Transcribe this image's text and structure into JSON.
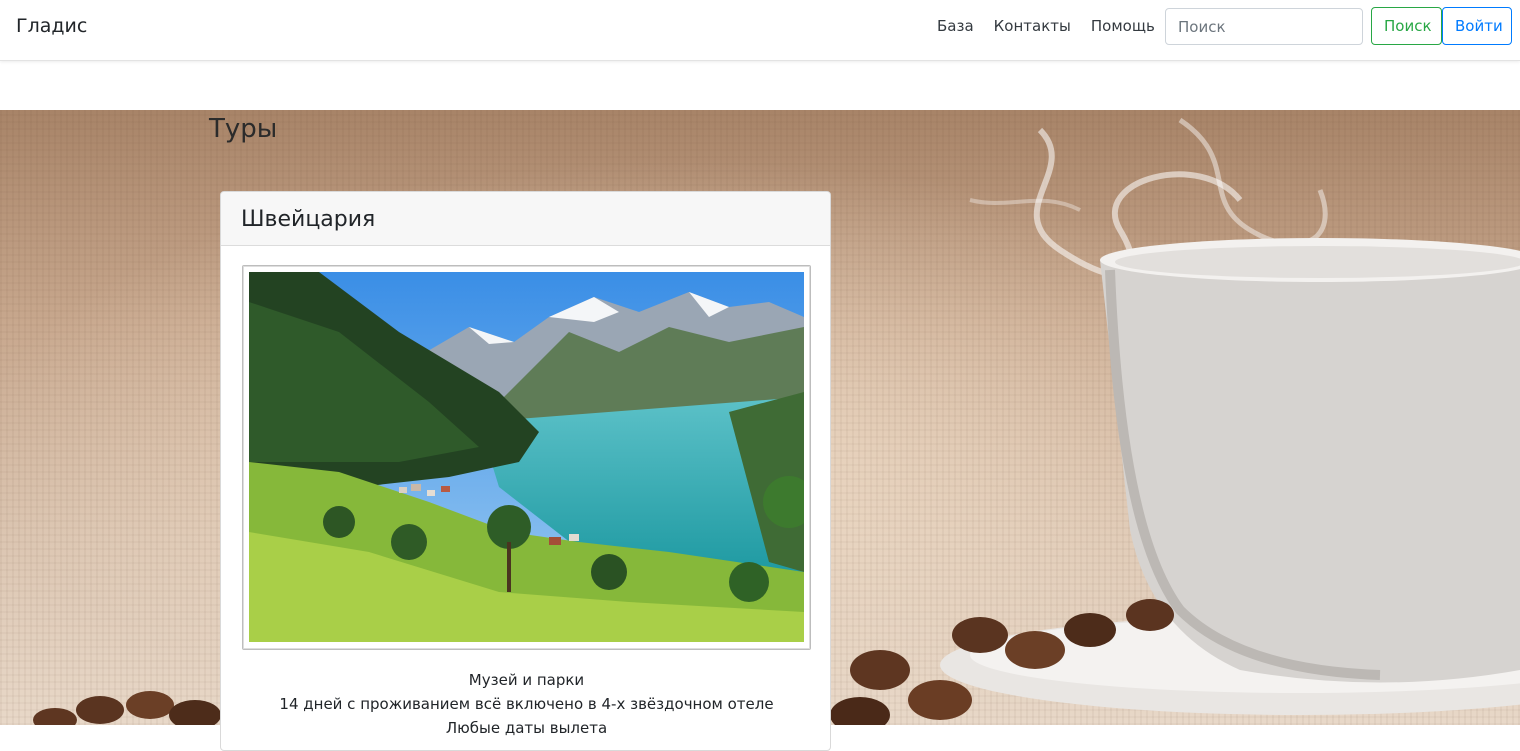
{
  "navbar": {
    "brand": "Гладис",
    "links": [
      "База",
      "Контакты",
      "Помощь"
    ],
    "search_placeholder": "Поиск",
    "search_button": "Поиск",
    "login_button": "Войти"
  },
  "page": {
    "title": "Туры"
  },
  "tour_card": {
    "title": "Швейцария",
    "image_icon": "mountain-lake-image",
    "lines": [
      "Музей и парки",
      "14 дней с проживанием всё включено в 4-х звёздочном отеле",
      "Любые даты вылета"
    ]
  },
  "colors": {
    "search_button": "#28a745",
    "login_button": "#007bff"
  }
}
